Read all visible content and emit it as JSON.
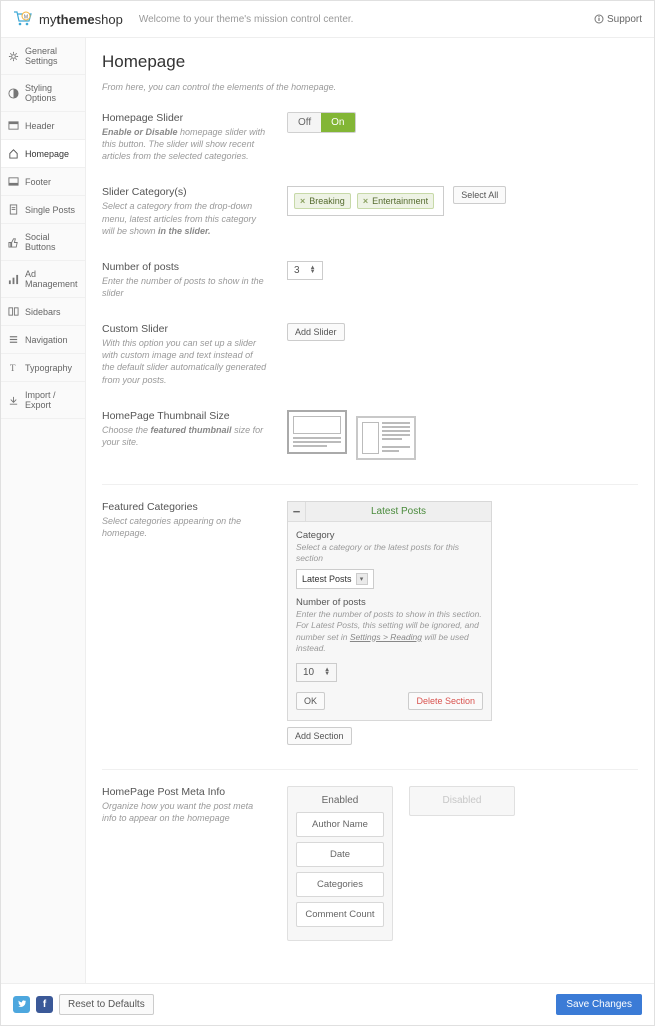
{
  "header": {
    "logo_pre": "my",
    "logo_bold": "theme",
    "logo_post": "shop",
    "welcome": "Welcome to your theme's mission control center.",
    "support": "Support"
  },
  "sidebar": {
    "items": [
      {
        "label": "General Settings"
      },
      {
        "label": "Styling Options"
      },
      {
        "label": "Header"
      },
      {
        "label": "Homepage"
      },
      {
        "label": "Footer"
      },
      {
        "label": "Single Posts"
      },
      {
        "label": "Social Buttons"
      },
      {
        "label": "Ad Management"
      },
      {
        "label": "Sidebars"
      },
      {
        "label": "Navigation"
      },
      {
        "label": "Typography"
      },
      {
        "label": "Import / Export"
      }
    ]
  },
  "page": {
    "title": "Homepage",
    "desc": "From here, you can control the elements of the homepage."
  },
  "slider": {
    "title": "Homepage Slider",
    "desc_pre": "Enable or Disable",
    "desc_rest": " homepage slider with this button. The slider will show recent articles from the selected categories.",
    "off": "Off",
    "on": "On"
  },
  "slider_cat": {
    "title": "Slider Category(s)",
    "desc_pre": "Select a category from the drop-down menu, latest articles from this category will be shown ",
    "desc_bold": "in the slider.",
    "tags": [
      "Breaking",
      "Entertainment"
    ],
    "select_all": "Select All"
  },
  "num_posts": {
    "title": "Number of posts",
    "desc": "Enter the number of posts to show in the slider",
    "value": "3"
  },
  "custom_slider": {
    "title": "Custom Slider",
    "desc": "With this option you can set up a slider with custom image and text instead of the default slider automatically generated from your posts.",
    "btn": "Add Slider"
  },
  "thumb": {
    "title": "HomePage Thumbnail Size",
    "desc_pre": "Choose the ",
    "desc_bold": "featured thumbnail",
    "desc_post": " size for your site."
  },
  "featured": {
    "title": "Featured Categories",
    "desc": "Select categories appearing on the homepage.",
    "panel_title": "Latest Posts",
    "cat_label": "Category",
    "cat_desc": "Select a category or the latest posts for this section",
    "cat_value": "Latest Posts",
    "np_label": "Number of posts",
    "np_desc1": "Enter the number of posts to show in this section.",
    "np_desc2_pre": "For Latest Posts, this setting will be ignored, and number set in ",
    "np_desc2_link": "Settings > Reading",
    "np_desc2_post": " will be used instead.",
    "np_value": "10",
    "ok": "OK",
    "delete": "Delete Section",
    "add": "Add Section"
  },
  "meta": {
    "title": "HomePage Post Meta Info",
    "desc": "Organize how you want the post meta info to appear on the homepage",
    "enabled": "Enabled",
    "disabled": "Disabled",
    "items": [
      "Author Name",
      "Date",
      "Categories",
      "Comment Count"
    ]
  },
  "footer": {
    "reset": "Reset to Defaults",
    "save": "Save Changes"
  }
}
